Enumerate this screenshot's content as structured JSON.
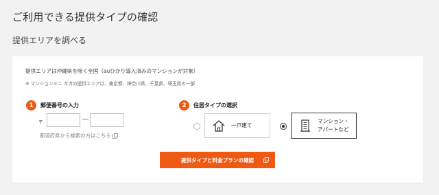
{
  "page": {
    "title": "ご利用できる提供タイプの確認",
    "subtitle": "提供エリアを調べる"
  },
  "area": {
    "note": "提供エリアは沖縄県を除く全国（auひかり導入済みのマンションが対象）",
    "sub_note": "※ マンションミニ ギガの提供エリアは、東京都、神奈川県、千葉県、埼玉県の一部"
  },
  "step1": {
    "number": "1",
    "label": "郵便番号の入力",
    "zip_mark": "〒",
    "zip_first_value": "",
    "zip_dash": "―",
    "zip_second_value": "",
    "link_text": "都道府県から検索の方はこちら",
    "link_icon": "external-link-icon"
  },
  "step2": {
    "number": "2",
    "label": "住居タイプの選択",
    "options": [
      {
        "label": "一戸建て",
        "icon": "house-icon",
        "selected": false
      },
      {
        "label": "マンション・\nアパートなど",
        "icon": "apartment-icon",
        "selected": true
      }
    ]
  },
  "submit": {
    "label": "提供タイプと料金プランの確認",
    "icon": "external-link-icon"
  },
  "colors": {
    "accent": "#ee5a14",
    "background": "#f2f2f2",
    "card": "#ffffff"
  }
}
